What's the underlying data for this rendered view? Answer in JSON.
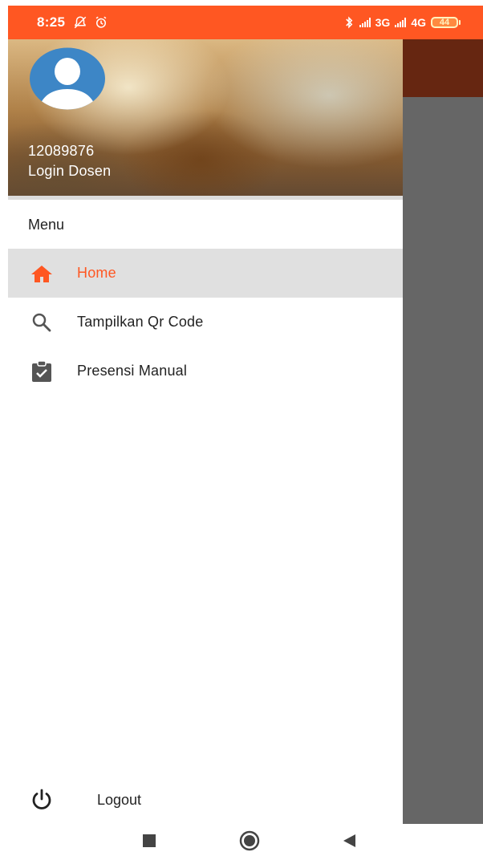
{
  "status_bar": {
    "time": "8:25",
    "network_3g": "3G",
    "network_4g": "4G",
    "battery_level": "44",
    "icons": [
      "notifications-off-icon",
      "alarm-icon",
      "bluetooth-icon",
      "signal-icon",
      "battery-icon"
    ]
  },
  "drawer": {
    "header": {
      "user_id": "12089876",
      "user_role": "Login Dosen",
      "avatar_icon": "user-avatar-icon"
    },
    "menu_heading": "Menu",
    "items": [
      {
        "label": "Home",
        "icon": "home-icon",
        "selected": true
      },
      {
        "label": "Tampilkan Qr Code",
        "icon": "search-icon",
        "selected": false
      },
      {
        "label": "Presensi Manual",
        "icon": "clipboard-check-icon",
        "selected": false
      }
    ],
    "logout": {
      "label": "Logout",
      "icon": "power-icon"
    }
  },
  "system_nav": {
    "icons": [
      "recent-apps-icon",
      "home-circle-icon",
      "back-icon"
    ]
  },
  "colors": {
    "accent": "#ff5722",
    "toolbar_behind": "#662611",
    "scrim": "#666666",
    "selected_row": "#e0e0e0",
    "avatar_blue": "#3d86c6"
  }
}
